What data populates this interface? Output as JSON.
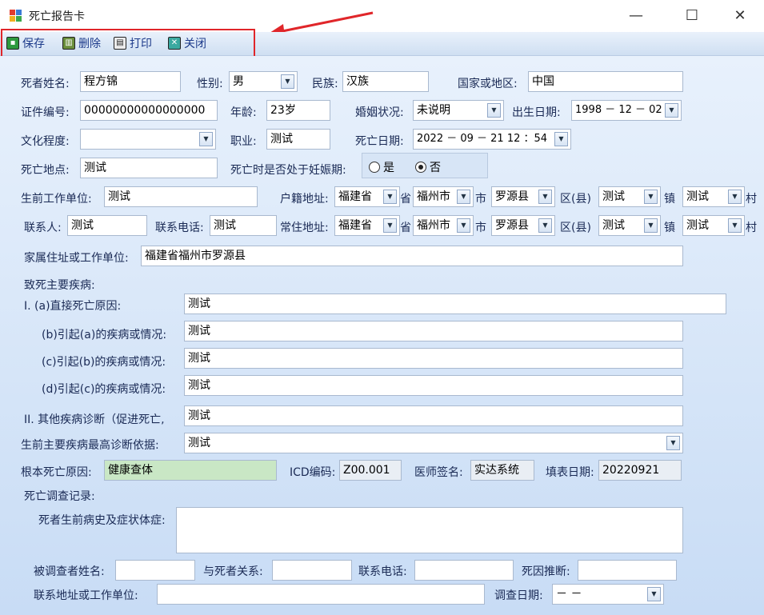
{
  "window": {
    "title": "死亡报告卡",
    "minimize": "—",
    "maximize": "☐",
    "close": "✕"
  },
  "toolbar": {
    "save_label": "保存",
    "delete_label": "删除",
    "print_label": "打印",
    "close_label": "关闭"
  },
  "colors": {
    "annotation_red": "#e0262a",
    "form_bg_top": "#e8f1fc",
    "form_bg_bottom": "#c8dcf5",
    "toolbar_text": "#1c3a8a",
    "highlight_green": "#c9e7c5"
  },
  "form": {
    "name_label": "死者姓名:",
    "name_value": "程方锦",
    "sex_label": "性别:",
    "sex_value": "男",
    "ethnic_label": "民族:",
    "ethnic_value": "汉族",
    "country_label": "国家或地区:",
    "country_value": "中国",
    "id_label": "证件编号:",
    "id_value": "00000000000000000",
    "age_label": "年龄:",
    "age_value": "23岁",
    "marital_label": "婚姻状况:",
    "marital_value": "未说明",
    "birth_label": "出生日期:",
    "birth_value": "1998 － 12 － 02",
    "education_label": "文化程度:",
    "education_value": "",
    "job_label": "职业:",
    "job_value": "测试",
    "death_date_label": "死亡日期:",
    "death_date_value": "2022 － 09 － 21    12 ：54",
    "death_place_label": "死亡地点:",
    "death_place_value": "测试",
    "pregnant_label": "死亡时是否处于妊娠期:",
    "pregnant_yes": "是",
    "pregnant_no": "否",
    "workplace_label": "生前工作单位:",
    "workplace_value": "测试",
    "household_label": "户籍地址:",
    "household": {
      "province": "福建省",
      "province_unit": "省",
      "city": "福州市",
      "city_unit": "市",
      "district": "罗源县",
      "district_unit": "区(县)",
      "town": "测试",
      "town_unit": "镇",
      "village": "测试",
      "village_unit": "村"
    },
    "contact_label": "联系人:",
    "contact_value": "测试",
    "contact_phone_label": "联系电话:",
    "contact_phone_value": "测试",
    "resident_label": "常住地址:",
    "resident": {
      "province": "福建省",
      "province_unit": "省",
      "city": "福州市",
      "city_unit": "市",
      "district": "罗源县",
      "district_unit": "区(县)",
      "town": "测试",
      "town_unit": "镇",
      "village": "测试",
      "village_unit": "村"
    },
    "family_address_label": "家属住址或工作单位:",
    "family_address_value": "福建省福州市罗源县",
    "disease_section_label": "致死主要疾病:",
    "cause_a_label": "I. (a)直接死亡原因:",
    "cause_a_value": "测试",
    "cause_b_label": "(b)引起(a)的疾病或情况:",
    "cause_b_value": "测试",
    "cause_c_label": "(c)引起(b)的疾病或情况:",
    "cause_c_value": "测试",
    "cause_d_label": "(d)引起(c)的疾病或情况:",
    "cause_d_value": "测试",
    "other_disease_label": "II. 其他疾病诊断（促进死亡,",
    "other_disease_value": "测试",
    "diagnosis_basis_label": "生前主要疾病最高诊断依据:",
    "diagnosis_basis_value": "测试",
    "root_cause_label": "根本死亡原因:",
    "root_cause_value": "健康查体",
    "icd_label": "ICD编码:",
    "icd_value": "Z00.001",
    "doctor_label": "医师签名:",
    "doctor_value": "实达系统",
    "fill_date_label": "填表日期:",
    "fill_date_value": "20220921",
    "survey_section_label": "死亡调查记录:",
    "history_label": "死者生前病史及症状体症:",
    "history_value": "",
    "respondent_label": "被调查者姓名:",
    "respondent_value": "",
    "relation_label": "与死者关系:",
    "relation_value": "",
    "survey_phone_label": "联系电话:",
    "survey_phone_value": "",
    "cause_inference_label": "死因推断:",
    "cause_inference_value": "",
    "survey_address_label": "联系地址或工作单位:",
    "survey_address_value": "",
    "survey_date_label": "调查日期:",
    "survey_date_value": " －  －"
  }
}
